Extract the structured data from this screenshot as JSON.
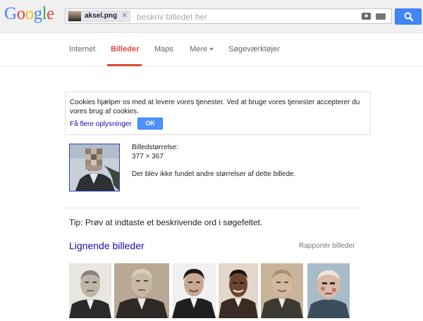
{
  "header": {
    "logo_text": "Google",
    "logo_letters": [
      {
        "ch": "G",
        "color": "#4285f4"
      },
      {
        "ch": "o",
        "color": "#ea4335"
      },
      {
        "ch": "o",
        "color": "#fbbc05"
      },
      {
        "ch": "g",
        "color": "#4285f4"
      },
      {
        "ch": "l",
        "color": "#34a853"
      },
      {
        "ch": "e",
        "color": "#ea4335"
      }
    ],
    "search_chip_filename": "aksel.png",
    "search_chip_close": "✕",
    "search_placeholder": "beskriv billedet her",
    "camera_icon": "camera-icon",
    "keyboard_icon": "keyboard-icon",
    "search_icon": "search-icon",
    "accent_color": "#4285f4"
  },
  "tabs": [
    {
      "label": "Internet"
    },
    {
      "label": "Billeder",
      "active": true
    },
    {
      "label": "Maps"
    },
    {
      "label": "Mere"
    },
    {
      "label": "Søgeværktøjer"
    }
  ],
  "cookie_notice": {
    "text": "Cookies hjælper os med at levere vores tjenester. Ved at bruge vores tjenester accepterer du vores brug af cookies.",
    "link": "Få flere oplysninger",
    "ok": "OK"
  },
  "image_info": {
    "size_label": "Billedstørrelse:",
    "size_value": "377 × 367",
    "no_other_sizes": "Der blev ikke fundet andre størrelser af dette billede."
  },
  "tip": "Tip: Prøv at indtaste et beskrivende ord i søgefeltet.",
  "similar": {
    "title": "Lignende billeder",
    "report": "Rapportér billeder",
    "count": 6
  }
}
